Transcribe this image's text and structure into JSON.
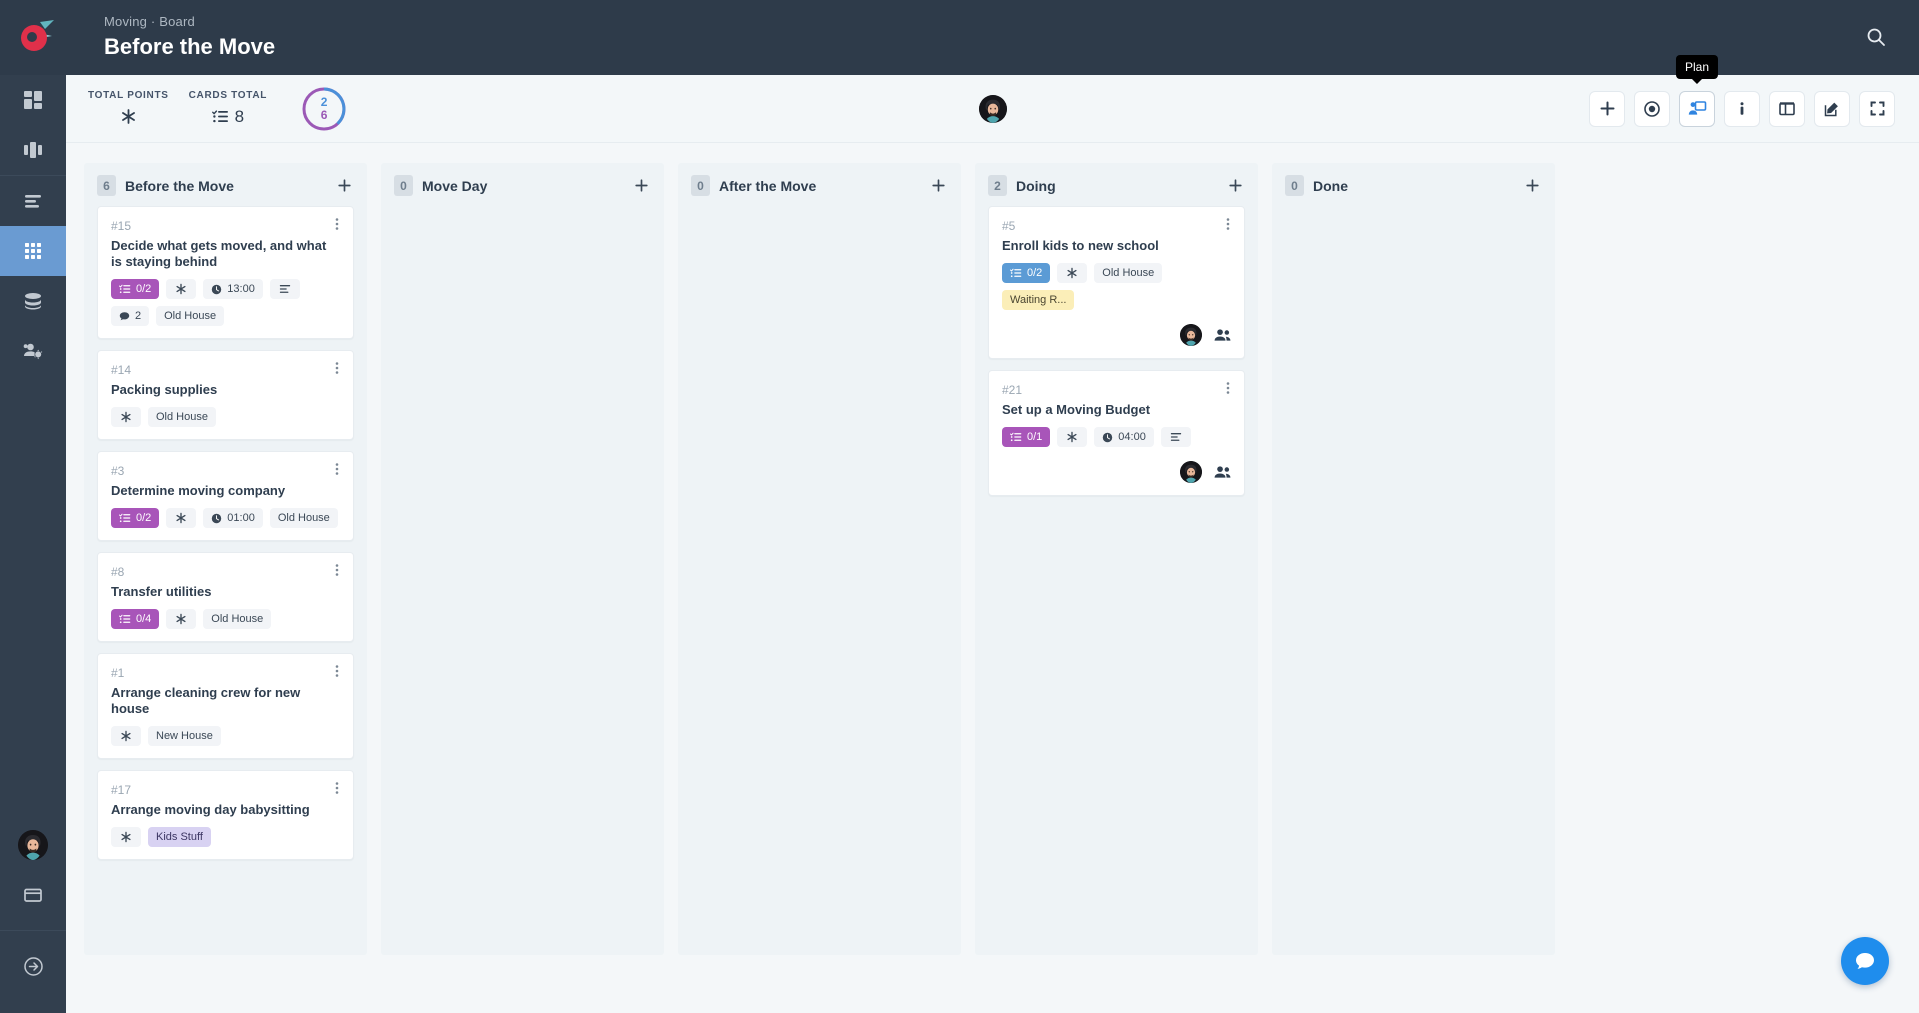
{
  "app": {
    "logo": "rocket-logo",
    "breadcrumb": "Moving · Board",
    "board_title": "Before the Move",
    "search_icon": "search-icon"
  },
  "sidebar": {
    "items": [
      {
        "name": "dashboard",
        "icon": "dashboard-grid-icon",
        "active": false
      },
      {
        "name": "boards",
        "icon": "columns-icon",
        "active": false
      },
      {
        "name": "backlog",
        "icon": "list-icon",
        "active": false
      },
      {
        "name": "grid",
        "icon": "grid-apps-icon",
        "active": true
      },
      {
        "name": "database",
        "icon": "database-icon",
        "active": false
      },
      {
        "name": "team-settings",
        "icon": "users-gear-icon",
        "active": false
      }
    ],
    "bottom": [
      {
        "name": "profile",
        "icon": "avatar"
      },
      {
        "name": "billing",
        "icon": "credit-card-icon"
      },
      {
        "name": "logout",
        "icon": "arrow-circle-right-icon"
      }
    ]
  },
  "stats": {
    "total_points": {
      "label": "TOTAL POINTS",
      "icon": "asterisk-icon",
      "value": ""
    },
    "cards_total": {
      "label": "CARDS TOTAL",
      "icon": "checklist-icon",
      "value": "8"
    },
    "progress": {
      "numerator": "2",
      "denominator": "6",
      "ring_color": "#9b59b6",
      "arc_color": "#4a90d9"
    },
    "avatar": "user-avatar"
  },
  "toolbar": {
    "tooltip": "Plan",
    "buttons": [
      {
        "name": "add-button",
        "icon": "plus-icon",
        "active": false
      },
      {
        "name": "target-button",
        "icon": "target-icon",
        "active": false
      },
      {
        "name": "plan-button",
        "icon": "plan-presenter-icon",
        "active": true
      },
      {
        "name": "info-button",
        "icon": "info-icon",
        "active": false
      },
      {
        "name": "layout-button",
        "icon": "layout-columns-icon",
        "active": false
      },
      {
        "name": "edit-button",
        "icon": "edit-pencil-icon",
        "active": false
      },
      {
        "name": "fullscreen-button",
        "icon": "fullscreen-icon",
        "active": false
      }
    ]
  },
  "chat": {
    "icon": "chat-bubble-icon",
    "color": "#1f8ded"
  },
  "columns": [
    {
      "name": "before-the-move",
      "count": "6",
      "title": "Before the Move",
      "add_icon": "plus-icon",
      "cards": [
        {
          "id": "#15",
          "title": "Decide what gets moved, and what is staying behind",
          "badges": [
            {
              "kind": "purple",
              "icon": "checklist-icon",
              "text": "0/2"
            },
            {
              "kind": "plain",
              "icon": "asterisk-icon",
              "text": ""
            },
            {
              "kind": "plain",
              "icon": "clock-icon",
              "text": "13:00"
            },
            {
              "kind": "plain",
              "icon": "description-icon",
              "text": ""
            },
            {
              "kind": "plain",
              "icon": "comment-icon",
              "text": "2"
            },
            {
              "kind": "plain",
              "icon": "",
              "text": "Old House"
            }
          ],
          "avatar": false,
          "people": false
        },
        {
          "id": "#14",
          "title": "Packing supplies",
          "badges": [
            {
              "kind": "plain",
              "icon": "asterisk-icon",
              "text": ""
            },
            {
              "kind": "plain",
              "icon": "",
              "text": "Old House"
            }
          ],
          "avatar": false,
          "people": false
        },
        {
          "id": "#3",
          "title": "Determine moving company",
          "badges": [
            {
              "kind": "purple",
              "icon": "checklist-icon",
              "text": "0/2"
            },
            {
              "kind": "plain",
              "icon": "asterisk-icon",
              "text": ""
            },
            {
              "kind": "plain",
              "icon": "clock-icon",
              "text": "01:00"
            },
            {
              "kind": "plain",
              "icon": "",
              "text": "Old House"
            }
          ],
          "avatar": false,
          "people": false
        },
        {
          "id": "#8",
          "title": "Transfer utilities",
          "badges": [
            {
              "kind": "purple",
              "icon": "checklist-icon",
              "text": "0/4"
            },
            {
              "kind": "plain",
              "icon": "asterisk-icon",
              "text": ""
            },
            {
              "kind": "plain",
              "icon": "",
              "text": "Old House"
            }
          ],
          "avatar": false,
          "people": false
        },
        {
          "id": "#1",
          "title": "Arrange cleaning crew for new house",
          "badges": [
            {
              "kind": "plain",
              "icon": "asterisk-icon",
              "text": ""
            },
            {
              "kind": "plain",
              "icon": "",
              "text": "New House"
            }
          ],
          "avatar": false,
          "people": false
        },
        {
          "id": "#17",
          "title": "Arrange moving day babysitting",
          "badges": [
            {
              "kind": "plain",
              "icon": "asterisk-icon",
              "text": ""
            },
            {
              "kind": "lavender",
              "icon": "",
              "text": "Kids Stuff"
            }
          ],
          "avatar": false,
          "people": false
        }
      ]
    },
    {
      "name": "move-day",
      "count": "0",
      "title": "Move Day",
      "add_icon": "plus-icon",
      "cards": []
    },
    {
      "name": "after-the-move",
      "count": "0",
      "title": "After the Move",
      "add_icon": "plus-icon",
      "cards": []
    },
    {
      "name": "doing",
      "count": "2",
      "title": "Doing",
      "add_icon": "plus-icon",
      "cards": [
        {
          "id": "#5",
          "title": "Enroll kids to new school",
          "badges": [
            {
              "kind": "blue",
              "icon": "checklist-icon",
              "text": "0/2"
            },
            {
              "kind": "plain",
              "icon": "asterisk-icon",
              "text": ""
            },
            {
              "kind": "plain",
              "icon": "",
              "text": "Old House"
            },
            {
              "kind": "yellow",
              "icon": "",
              "text": "Waiting R..."
            }
          ],
          "avatar": true,
          "people": true
        },
        {
          "id": "#21",
          "title": "Set up a Moving Budget",
          "badges": [
            {
              "kind": "purple",
              "icon": "checklist-icon",
              "text": "0/1"
            },
            {
              "kind": "plain",
              "icon": "asterisk-icon",
              "text": ""
            },
            {
              "kind": "plain",
              "icon": "clock-icon",
              "text": "04:00"
            },
            {
              "kind": "plain",
              "icon": "description-icon",
              "text": ""
            }
          ],
          "avatar": true,
          "people": true
        }
      ]
    },
    {
      "name": "done",
      "count": "0",
      "title": "Done",
      "add_icon": "plus-icon",
      "cards": []
    }
  ]
}
